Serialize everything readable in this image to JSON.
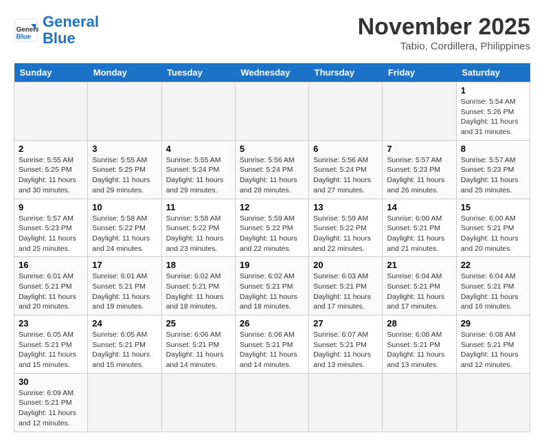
{
  "header": {
    "logo_general": "General",
    "logo_blue": "Blue",
    "month_title": "November 2025",
    "location": "Tabio, Cordillera, Philippines"
  },
  "weekdays": [
    "Sunday",
    "Monday",
    "Tuesday",
    "Wednesday",
    "Thursday",
    "Friday",
    "Saturday"
  ],
  "weeks": [
    [
      {
        "day": "",
        "info": ""
      },
      {
        "day": "",
        "info": ""
      },
      {
        "day": "",
        "info": ""
      },
      {
        "day": "",
        "info": ""
      },
      {
        "day": "",
        "info": ""
      },
      {
        "day": "",
        "info": ""
      },
      {
        "day": "1",
        "info": "Sunrise: 5:54 AM\nSunset: 5:26 PM\nDaylight: 11 hours\nand 31 minutes."
      }
    ],
    [
      {
        "day": "2",
        "info": "Sunrise: 5:55 AM\nSunset: 5:25 PM\nDaylight: 11 hours\nand 30 minutes."
      },
      {
        "day": "3",
        "info": "Sunrise: 5:55 AM\nSunset: 5:25 PM\nDaylight: 11 hours\nand 29 minutes."
      },
      {
        "day": "4",
        "info": "Sunrise: 5:55 AM\nSunset: 5:24 PM\nDaylight: 11 hours\nand 29 minutes."
      },
      {
        "day": "5",
        "info": "Sunrise: 5:56 AM\nSunset: 5:24 PM\nDaylight: 11 hours\nand 28 minutes."
      },
      {
        "day": "6",
        "info": "Sunrise: 5:56 AM\nSunset: 5:24 PM\nDaylight: 11 hours\nand 27 minutes."
      },
      {
        "day": "7",
        "info": "Sunrise: 5:57 AM\nSunset: 5:23 PM\nDaylight: 11 hours\nand 26 minutes."
      },
      {
        "day": "8",
        "info": "Sunrise: 5:57 AM\nSunset: 5:23 PM\nDaylight: 11 hours\nand 25 minutes."
      }
    ],
    [
      {
        "day": "9",
        "info": "Sunrise: 5:57 AM\nSunset: 5:23 PM\nDaylight: 11 hours\nand 25 minutes."
      },
      {
        "day": "10",
        "info": "Sunrise: 5:58 AM\nSunset: 5:22 PM\nDaylight: 11 hours\nand 24 minutes."
      },
      {
        "day": "11",
        "info": "Sunrise: 5:58 AM\nSunset: 5:22 PM\nDaylight: 11 hours\nand 23 minutes."
      },
      {
        "day": "12",
        "info": "Sunrise: 5:59 AM\nSunset: 5:22 PM\nDaylight: 11 hours\nand 22 minutes."
      },
      {
        "day": "13",
        "info": "Sunrise: 5:59 AM\nSunset: 5:22 PM\nDaylight: 11 hours\nand 22 minutes."
      },
      {
        "day": "14",
        "info": "Sunrise: 6:00 AM\nSunset: 5:21 PM\nDaylight: 11 hours\nand 21 minutes."
      },
      {
        "day": "15",
        "info": "Sunrise: 6:00 AM\nSunset: 5:21 PM\nDaylight: 11 hours\nand 20 minutes."
      }
    ],
    [
      {
        "day": "16",
        "info": "Sunrise: 6:01 AM\nSunset: 5:21 PM\nDaylight: 11 hours\nand 20 minutes."
      },
      {
        "day": "17",
        "info": "Sunrise: 6:01 AM\nSunset: 5:21 PM\nDaylight: 11 hours\nand 19 minutes."
      },
      {
        "day": "18",
        "info": "Sunrise: 6:02 AM\nSunset: 5:21 PM\nDaylight: 11 hours\nand 18 minutes."
      },
      {
        "day": "19",
        "info": "Sunrise: 6:02 AM\nSunset: 5:21 PM\nDaylight: 11 hours\nand 18 minutes."
      },
      {
        "day": "20",
        "info": "Sunrise: 6:03 AM\nSunset: 5:21 PM\nDaylight: 11 hours\nand 17 minutes."
      },
      {
        "day": "21",
        "info": "Sunrise: 6:04 AM\nSunset: 5:21 PM\nDaylight: 11 hours\nand 17 minutes."
      },
      {
        "day": "22",
        "info": "Sunrise: 6:04 AM\nSunset: 5:21 PM\nDaylight: 11 hours\nand 16 minutes."
      }
    ],
    [
      {
        "day": "23",
        "info": "Sunrise: 6:05 AM\nSunset: 5:21 PM\nDaylight: 11 hours\nand 15 minutes."
      },
      {
        "day": "24",
        "info": "Sunrise: 6:05 AM\nSunset: 5:21 PM\nDaylight: 11 hours\nand 15 minutes."
      },
      {
        "day": "25",
        "info": "Sunrise: 6:06 AM\nSunset: 5:21 PM\nDaylight: 11 hours\nand 14 minutes."
      },
      {
        "day": "26",
        "info": "Sunrise: 6:06 AM\nSunset: 5:21 PM\nDaylight: 11 hours\nand 14 minutes."
      },
      {
        "day": "27",
        "info": "Sunrise: 6:07 AM\nSunset: 5:21 PM\nDaylight: 11 hours\nand 13 minutes."
      },
      {
        "day": "28",
        "info": "Sunrise: 6:08 AM\nSunset: 5:21 PM\nDaylight: 11 hours\nand 13 minutes."
      },
      {
        "day": "29",
        "info": "Sunrise: 6:08 AM\nSunset: 5:21 PM\nDaylight: 11 hours\nand 12 minutes."
      }
    ],
    [
      {
        "day": "30",
        "info": "Sunrise: 6:09 AM\nSunset: 5:21 PM\nDaylight: 11 hours\nand 12 minutes."
      },
      {
        "day": "",
        "info": ""
      },
      {
        "day": "",
        "info": ""
      },
      {
        "day": "",
        "info": ""
      },
      {
        "day": "",
        "info": ""
      },
      {
        "day": "",
        "info": ""
      },
      {
        "day": "",
        "info": ""
      }
    ]
  ]
}
